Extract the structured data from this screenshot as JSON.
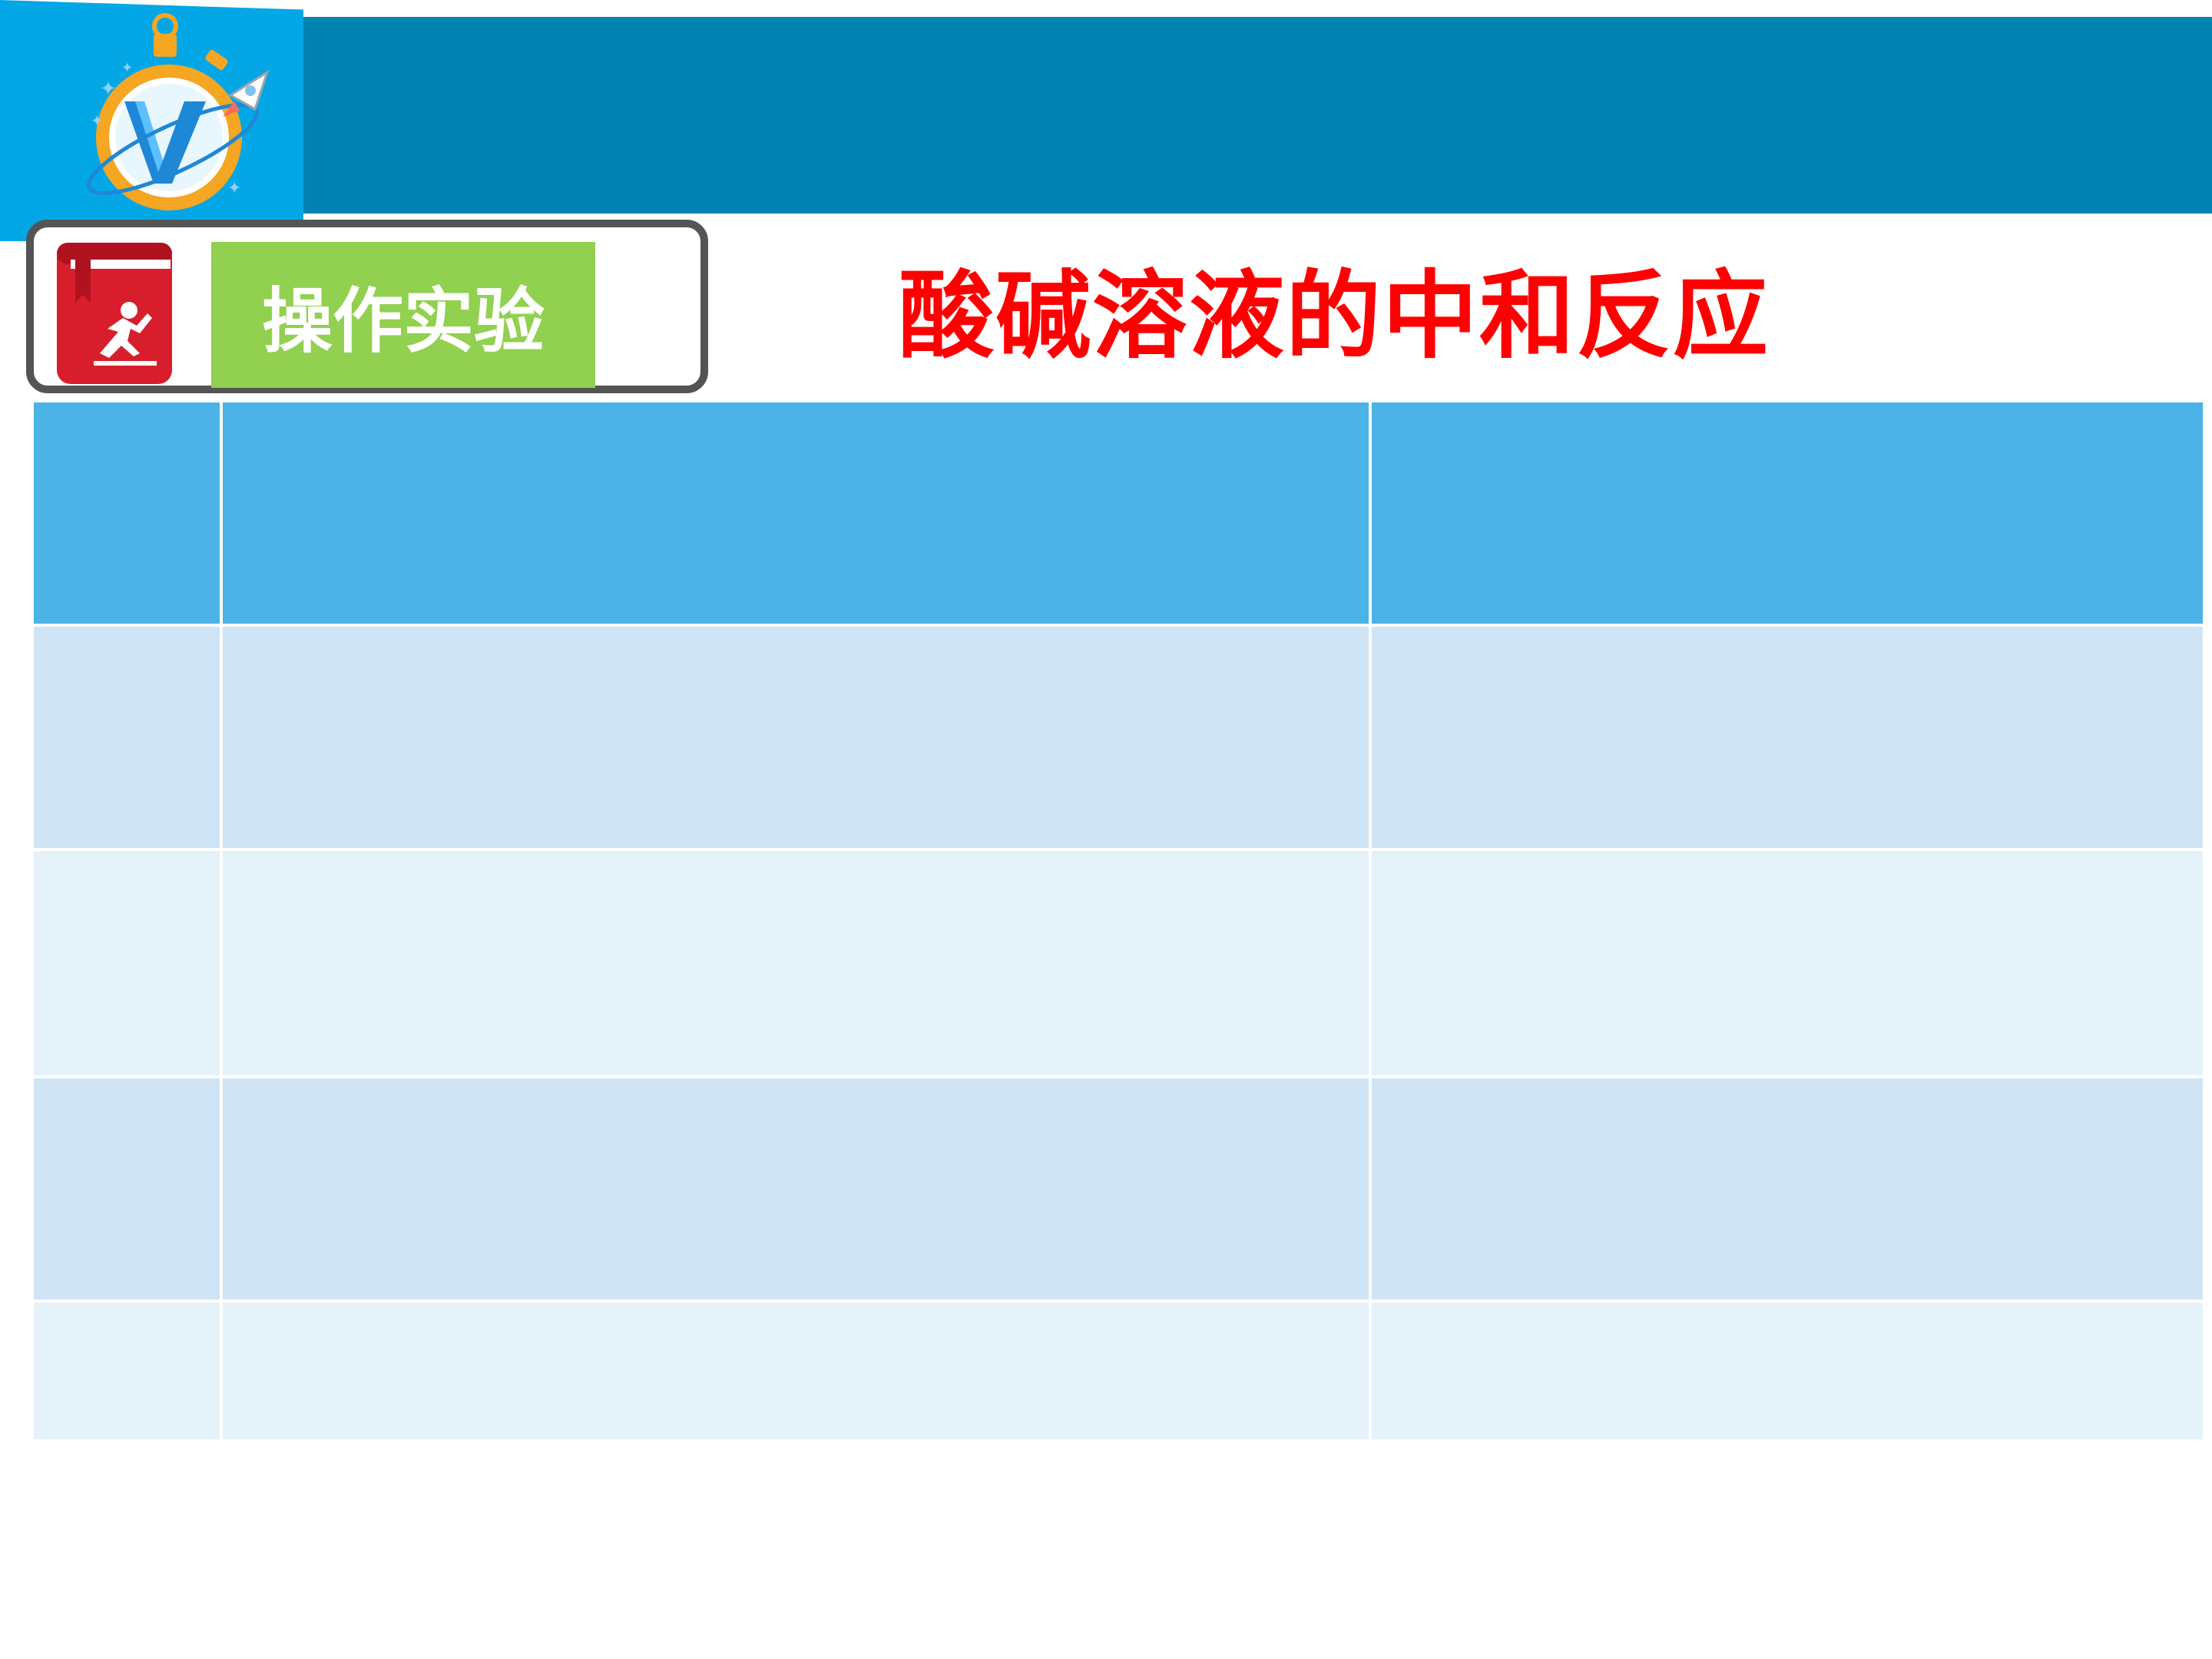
{
  "header": {
    "section_label": "操作实验",
    "title": "酸碱溶液的中和反应"
  },
  "colors": {
    "banner_dark": "#0083b2",
    "banner_light": "#03a7e6",
    "section_label_bg": "#92d050",
    "title_text": "#ff0000",
    "table_header": "#4bb3e5",
    "table_row_odd": "#cfe4f4",
    "table_row_even": "#e6f2fa"
  },
  "icons": {
    "logo": "stopwatch-v-rocket-logo",
    "section": "red-book-runner-icon"
  },
  "table": {
    "columns": 3,
    "rows": [
      [
        "",
        "",
        ""
      ],
      [
        "",
        "",
        ""
      ],
      [
        "",
        "",
        ""
      ],
      [
        "",
        "",
        ""
      ],
      [
        "",
        "",
        ""
      ]
    ]
  }
}
